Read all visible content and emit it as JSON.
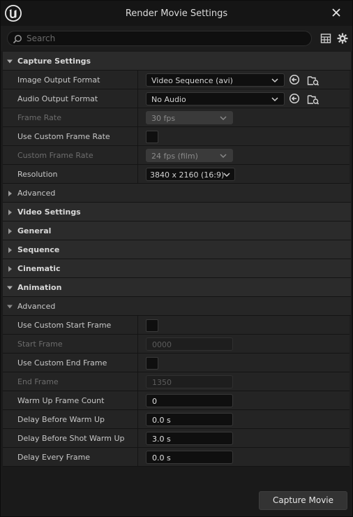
{
  "window": {
    "title": "Render Movie Settings"
  },
  "search": {
    "placeholder": "Search",
    "value": ""
  },
  "sections": {
    "capture": {
      "label": "Capture Settings",
      "image_output_format": {
        "label": "Image Output Format",
        "value": "Video Sequence (avi)"
      },
      "audio_output_format": {
        "label": "Audio Output Format",
        "value": "No Audio"
      },
      "frame_rate": {
        "label": "Frame Rate",
        "value": "30 fps"
      },
      "use_custom_frame_rate": {
        "label": "Use Custom Frame Rate",
        "checked": false
      },
      "custom_frame_rate": {
        "label": "Custom Frame Rate",
        "value": "24 fps (film)"
      },
      "resolution": {
        "label": "Resolution",
        "value": "3840 x 2160 (16:9)"
      },
      "advanced": {
        "label": "Advanced"
      }
    },
    "video_settings": {
      "label": "Video Settings"
    },
    "general": {
      "label": "General"
    },
    "sequence": {
      "label": "Sequence"
    },
    "cinematic": {
      "label": "Cinematic"
    },
    "animation": {
      "label": "Animation",
      "advanced": {
        "label": "Advanced",
        "use_custom_start_frame": {
          "label": "Use Custom Start Frame",
          "checked": false
        },
        "start_frame": {
          "label": "Start Frame",
          "value": "0000"
        },
        "use_custom_end_frame": {
          "label": "Use Custom End Frame",
          "checked": false
        },
        "end_frame": {
          "label": "End Frame",
          "value": "1350"
        },
        "warm_up_frame_count": {
          "label": "Warm Up Frame Count",
          "value": "0"
        },
        "delay_before_warm_up": {
          "label": "Delay Before Warm Up",
          "value": "0.0 s"
        },
        "delay_before_shot_warm_up": {
          "label": "Delay Before Shot Warm Up",
          "value": "3.0 s"
        },
        "delay_every_frame": {
          "label": "Delay Every Frame",
          "value": "0.0 s"
        }
      }
    }
  },
  "footer": {
    "capture_label": "Capture Movie"
  },
  "colors": {
    "background": "#1a1a1a",
    "row": "#242424",
    "category": "#2b2b2b",
    "field": "#0f0f0f"
  },
  "icons": [
    "unreal-logo-icon",
    "close-icon",
    "search-icon",
    "table-view-icon",
    "gear-icon",
    "reset-arrow-icon",
    "browse-folder-icon",
    "chevron-down-icon",
    "collapse-arrow-icon",
    "expand-arrow-icon"
  ]
}
